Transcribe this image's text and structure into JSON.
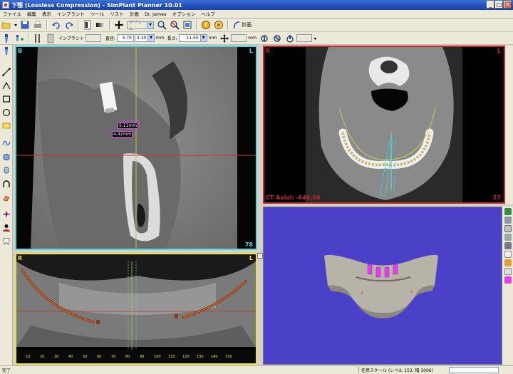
{
  "window": {
    "title": "下顎 (Lossless Compression) - SimPlant Planner 10.01",
    "minimize": "_",
    "maximize": "□",
    "close": "✕"
  },
  "menu": [
    "ファイル",
    "編集",
    "表示",
    "インプラント",
    "ツール",
    "リスト",
    "計画",
    "Dr. James",
    "オプション",
    "ヘルプ"
  ],
  "toolbar1": {
    "zoom_combo": "ボリュム",
    "plan_label": "計画"
  },
  "toolbar2": {
    "implant_label": "インプラント",
    "implant_value": "",
    "diameter_label": "直径:",
    "diameter_value": "3.70",
    "diameter_select": "3.10",
    "diameter_unit": "mm",
    "length_label": "長さ:",
    "length_value": "11.50",
    "length_unit": "mm",
    "offset_value": "",
    "offset_unit": "mm",
    "extra_combo": ""
  },
  "views": {
    "sagittal": {
      "left_label": "B",
      "right_label": "L",
      "slice_number": "78",
      "measure1": "5.11mm",
      "measure2": "4.42mm"
    },
    "axial": {
      "left_label": "R",
      "right_label": "L",
      "caption": "CT Axial: -646.00",
      "slice_number": "27"
    },
    "panoramic": {
      "left_label": "R",
      "right_label": "L",
      "ticks": [
        "10",
        "20",
        "30",
        "40",
        "50",
        "60",
        "70",
        "80",
        "90",
        "100",
        "110",
        "120",
        "130",
        "140",
        "150"
      ]
    }
  },
  "status": {
    "left": "完了",
    "scale": "任意スケール (レベル 153, 幅 3006)"
  },
  "colors": {
    "sagittal_border": "#52d5de",
    "axial_border": "#c1272d",
    "pano_border": "#e8e23a",
    "render_bg": "#4b40c8",
    "implant": "#e040e8",
    "nerve": "#8b3a1a"
  }
}
